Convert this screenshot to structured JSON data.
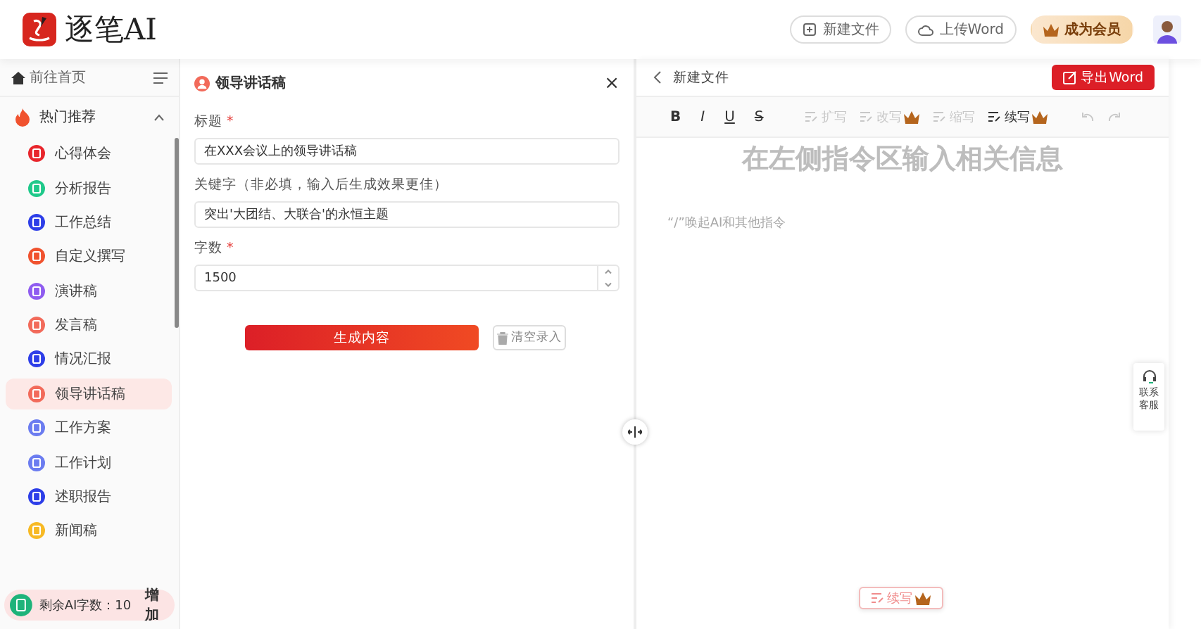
{
  "header": {
    "logo_text": "逐笔AI",
    "buttons": [
      {
        "kind": "new",
        "label": "新建文件"
      },
      {
        "kind": "upload",
        "label": "上传Word"
      },
      {
        "kind": "vip",
        "label": "成为会员"
      }
    ]
  },
  "sidebar": {
    "home": "前往首页",
    "section": {
      "label": "热门推荐",
      "expanded": true
    },
    "items": [
      {
        "label": "心得体会",
        "color": "#e8262c",
        "selected": false
      },
      {
        "label": "分析报告",
        "color": "#1fc98a",
        "selected": false
      },
      {
        "label": "工作总结",
        "color": "#2d3ee8",
        "selected": false
      },
      {
        "label": "自定义撰写",
        "color": "#f0522e",
        "selected": false
      },
      {
        "label": "演讲稿",
        "color": "#8f5cf0",
        "selected": false
      },
      {
        "label": "发言稿",
        "color": "#f26a5a",
        "selected": false
      },
      {
        "label": "情况汇报",
        "color": "#2d3ee8",
        "selected": false
      },
      {
        "label": "领导讲话稿",
        "color": "#f26a5a",
        "selected": true
      },
      {
        "label": "工作方案",
        "color": "#6b7cf0",
        "selected": false
      },
      {
        "label": "工作计划",
        "color": "#6b7cf0",
        "selected": false
      },
      {
        "label": "述职报告",
        "color": "#2d3ee8",
        "selected": false
      },
      {
        "label": "新闻稿",
        "color": "#f7b924",
        "selected": false
      }
    ],
    "quota": {
      "label": "剩余AI字数：10",
      "action": "增加"
    }
  },
  "form": {
    "title": "领导讲话稿",
    "close": "×",
    "required_mark": "*",
    "fields": [
      {
        "kind": "text",
        "label": "标题",
        "required": true,
        "value": "在XXX会议上的领导讲话稿"
      },
      {
        "kind": "text",
        "label": "关键字（非必填，输入后生成效果更佳）",
        "required": false,
        "value": "突出'大团结、大联合'的永恒主题"
      },
      {
        "kind": "number",
        "label": "字数",
        "required": true,
        "value": "1500"
      }
    ],
    "submit": "生成内容",
    "clear": "清空录入"
  },
  "editor": {
    "title": "新建文件",
    "export": "导出Word",
    "toolbar": [
      {
        "kind": "bold",
        "label": "B"
      },
      {
        "kind": "italic",
        "label": "I"
      },
      {
        "kind": "underline",
        "label": "U"
      },
      {
        "kind": "strike",
        "label": "S"
      },
      {
        "kind": "ai",
        "label": "扩写",
        "disabled": true,
        "premium": false
      },
      {
        "kind": "ai",
        "label": "改写",
        "disabled": true,
        "premium": true
      },
      {
        "kind": "ai",
        "label": "缩写",
        "disabled": true,
        "premium": false
      },
      {
        "kind": "ai",
        "label": "续写",
        "disabled": false,
        "premium": true
      },
      {
        "kind": "undo",
        "disabled": true
      },
      {
        "kind": "redo",
        "disabled": true
      }
    ],
    "heading": "在左侧指令区输入相关信息",
    "hint": "“/”唤起AI和其他指令",
    "float_button": {
      "label": "续写",
      "premium": true
    }
  },
  "contact": {
    "label": "联系客服"
  }
}
